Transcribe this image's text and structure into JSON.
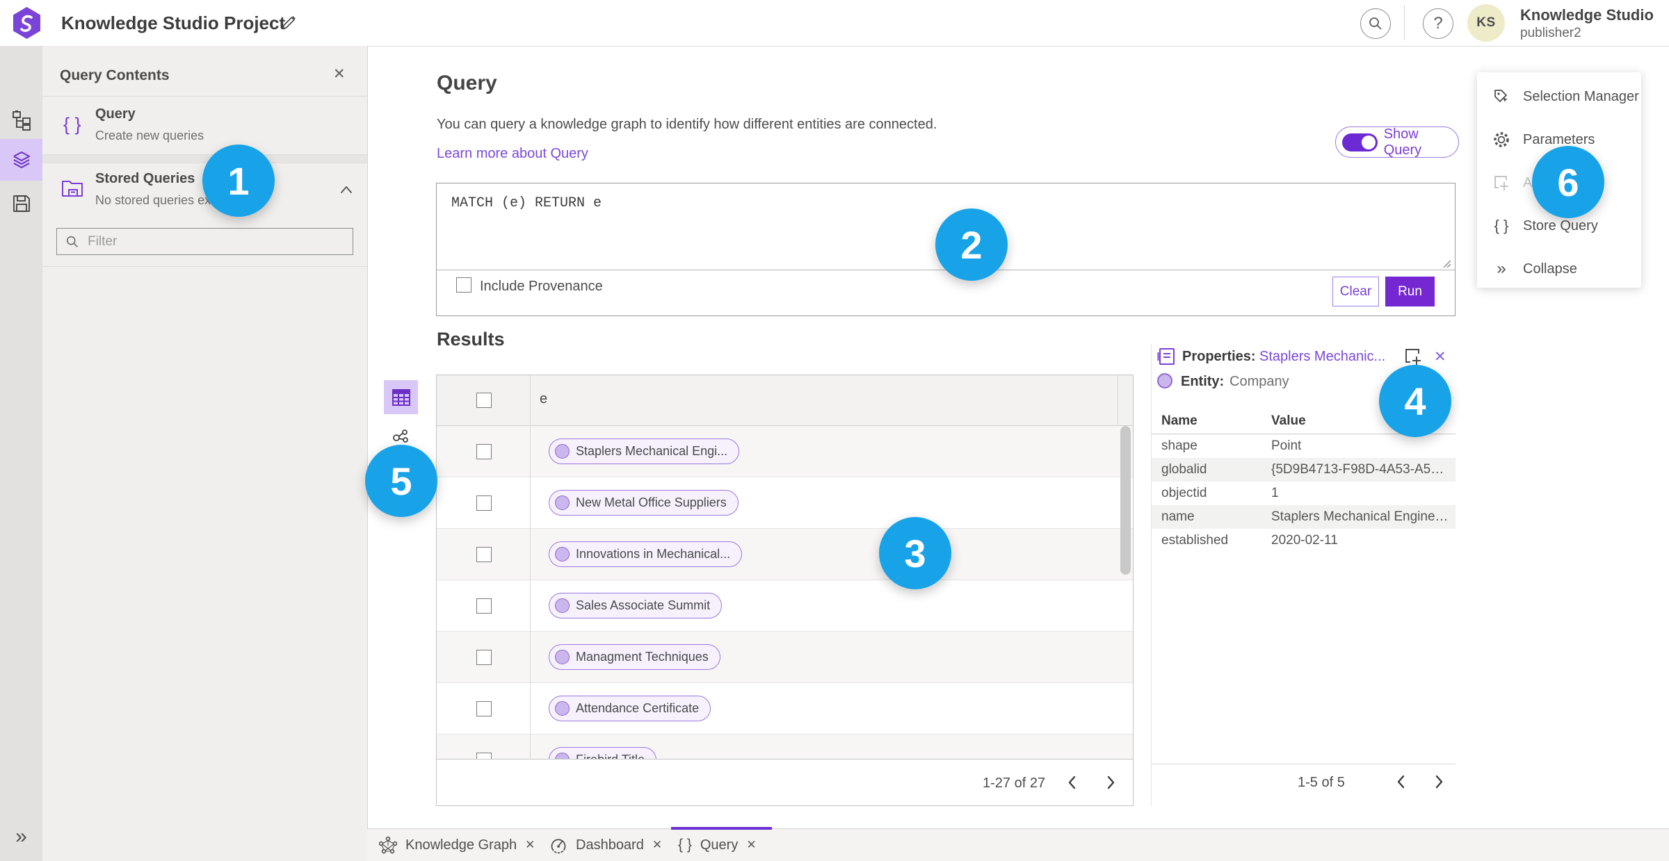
{
  "header": {
    "title": "Knowledge Studio Project",
    "user_name": "Knowledge Studio",
    "user_sub": "publisher2",
    "avatar_initials": "KS"
  },
  "sidebar": {
    "panel_title": "Query Contents",
    "items": [
      {
        "title": "Query",
        "subtitle": "Create new queries"
      },
      {
        "title": "Stored Queries",
        "subtitle": "No stored queries exist"
      }
    ],
    "filter_placeholder": "Filter"
  },
  "query": {
    "heading": "Query",
    "description": "You can query a knowledge graph to identify how different entities are connected.",
    "learn_link": "Learn more about Query",
    "show_query_label": "Show Query",
    "code": "MATCH (e) RETURN e",
    "include_provenance_label": "Include Provenance",
    "clear_label": "Clear",
    "run_label": "Run"
  },
  "results": {
    "heading": "Results",
    "column": "e",
    "rows": [
      "Staplers Mechanical Engi...",
      "New Metal Office Suppliers",
      "Innovations in Mechanical...",
      "Sales Associate Summit",
      "Managment Techniques",
      "Attendance Certificate",
      "Firebird Title"
    ],
    "pagination": "1-27 of 27"
  },
  "properties": {
    "title_label": "Properties:",
    "title_link": "Staplers Mechanic...",
    "entity_label": "Entity:",
    "entity_value": "Company",
    "col_name": "Name",
    "col_value": "Value",
    "rows": [
      {
        "name": "shape",
        "value": "Point"
      },
      {
        "name": "globalid",
        "value": "{5D9B4713-F98D-4A53-A59F-C11..."
      },
      {
        "name": "objectid",
        "value": "1"
      },
      {
        "name": "name",
        "value": "Staplers Mechanical Engineering"
      },
      {
        "name": "established",
        "value": "2020-02-11"
      }
    ],
    "pagination": "1-5 of 5"
  },
  "side_menu": {
    "items": [
      {
        "label": "Selection Manager"
      },
      {
        "label": "Parameters"
      },
      {
        "label": "Add"
      },
      {
        "label": "Store Query"
      },
      {
        "label": "Collapse"
      }
    ]
  },
  "tabs": {
    "items": [
      {
        "label": "Knowledge Graph"
      },
      {
        "label": "Dashboard"
      },
      {
        "label": "Query"
      }
    ]
  },
  "badges": [
    "1",
    "2",
    "3",
    "4",
    "5",
    "6"
  ],
  "glyphs": {
    "braces": "{ }",
    "collapse": "»",
    "expand": "»",
    "close": "✕",
    "help": "?"
  },
  "colors": {
    "accent_purple": "#7a3fd9",
    "run_button": "#7527d2",
    "badge_blue": "#18a3e9",
    "selected_rail": "#d9c7f7"
  }
}
